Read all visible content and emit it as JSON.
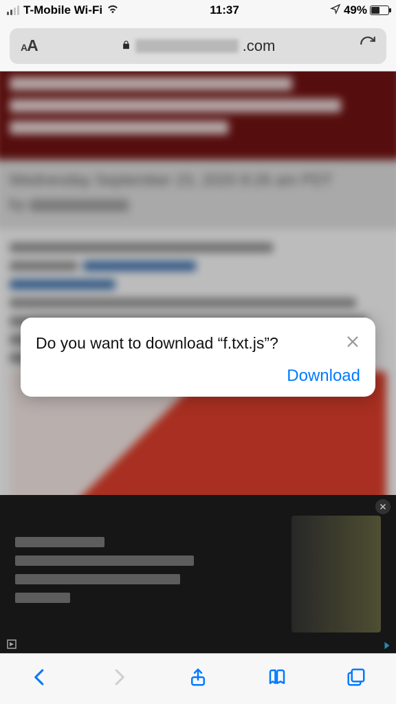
{
  "status": {
    "carrier": "T-Mobile Wi-Fi",
    "time": "11:37",
    "battery_pct": "49%"
  },
  "urlbar": {
    "domain_suffix": ".com"
  },
  "article": {
    "date_line": "Wednesday September 23, 2020 8:26 am PDT",
    "by_label": "by"
  },
  "modal": {
    "prompt": "Do you want to download “f.txt.js”?",
    "download_label": "Download"
  },
  "colors": {
    "ios_blue": "#007aff"
  }
}
